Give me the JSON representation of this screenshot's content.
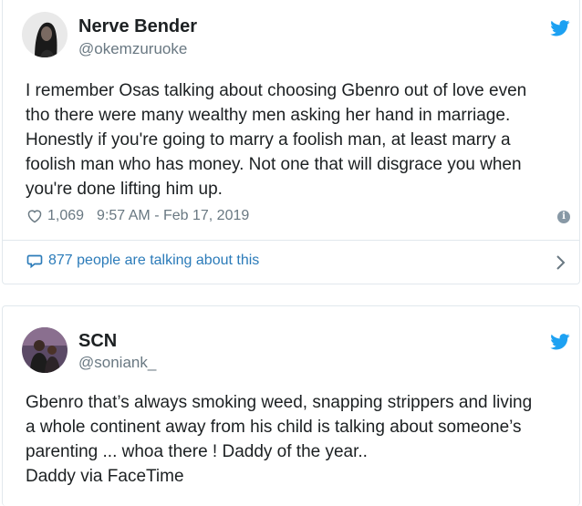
{
  "tweet1": {
    "author_name": "Nerve Bender",
    "handle": "@okemzuruoke",
    "text_lines": [
      "I remember Osas talking about choosing Gbenro out of love even",
      "tho there were many wealthy men asking her hand in marriage.",
      "Honestly if you're going to marry a foolish man, at least marry a",
      "foolish man who has money. Not one that will disgrace you when",
      "you're done lifting him up."
    ],
    "likes": "1,069",
    "timestamp": "9:57 AM - Feb 17, 2019",
    "talking": "877 people are talking about this"
  },
  "tweet2": {
    "author_name": "SCN",
    "handle": "@soniank_",
    "text_lines": [
      "Gbenro that’s always smoking weed, snapping strippers and living",
      "a whole continent away from his child  is talking about someone’s",
      "parenting ... whoa there ! Daddy of the year..",
      "Daddy via FaceTime"
    ]
  },
  "colors": {
    "twitter_blue": "#1da1f2",
    "link_blue": "#2b7bb9",
    "muted": "#697882",
    "border": "#e1e8ed"
  },
  "icons": [
    "twitter-bird-icon",
    "heart-icon",
    "info-icon",
    "speech-bubble-icon",
    "chevron-right-icon"
  ]
}
